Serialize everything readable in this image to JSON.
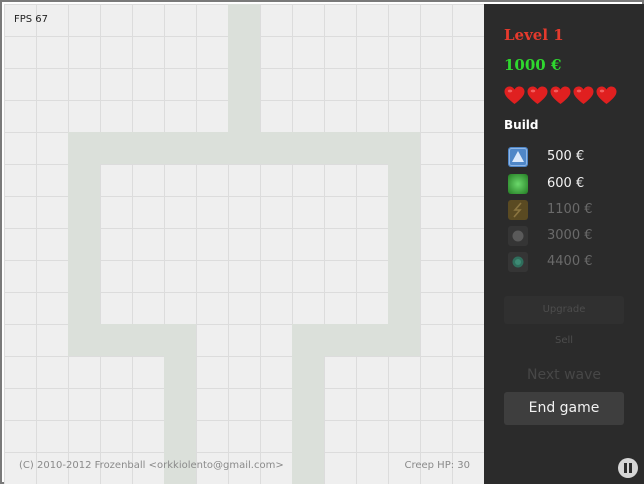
{
  "board": {
    "fps_label": "FPS 67",
    "copyright": "(C) 2010-2012 Frozenball <orkkiolento@gmail.com>",
    "creep_hp": "Creep HP: 30",
    "path_color": "#dbe0da",
    "grid_color": "#dcdcdc"
  },
  "panel": {
    "level": "Level 1",
    "money": "1000 €",
    "lives": 5,
    "build_title": "Build",
    "towers": [
      {
        "price": "500 €",
        "icon": "triangle-tower-icon",
        "enabled": true,
        "color": "#4f87c8"
      },
      {
        "price": "600 €",
        "icon": "green-square-tower-icon",
        "enabled": true,
        "color": "#3fae3f"
      },
      {
        "price": "1100 €",
        "icon": "lightning-tower-icon",
        "enabled": false,
        "color": "#6f5a2a"
      },
      {
        "price": "3000 €",
        "icon": "dark-circle-tower-icon",
        "enabled": false,
        "color": "#555555"
      },
      {
        "price": "4400 €",
        "icon": "teal-circle-tower-icon",
        "enabled": false,
        "color": "#2f6e5c"
      }
    ],
    "upgrade_label": "Upgrade",
    "sell_label": "Sell",
    "next_wave_label": "Next wave",
    "end_game_label": "End game",
    "pause_icon": "pause-icon"
  },
  "colors": {
    "level": "#e53a2d",
    "money": "#2fd82f",
    "heart": "#e02020",
    "enabled_text": "#f2f2f2",
    "disabled_text": "#6a6a6a"
  }
}
